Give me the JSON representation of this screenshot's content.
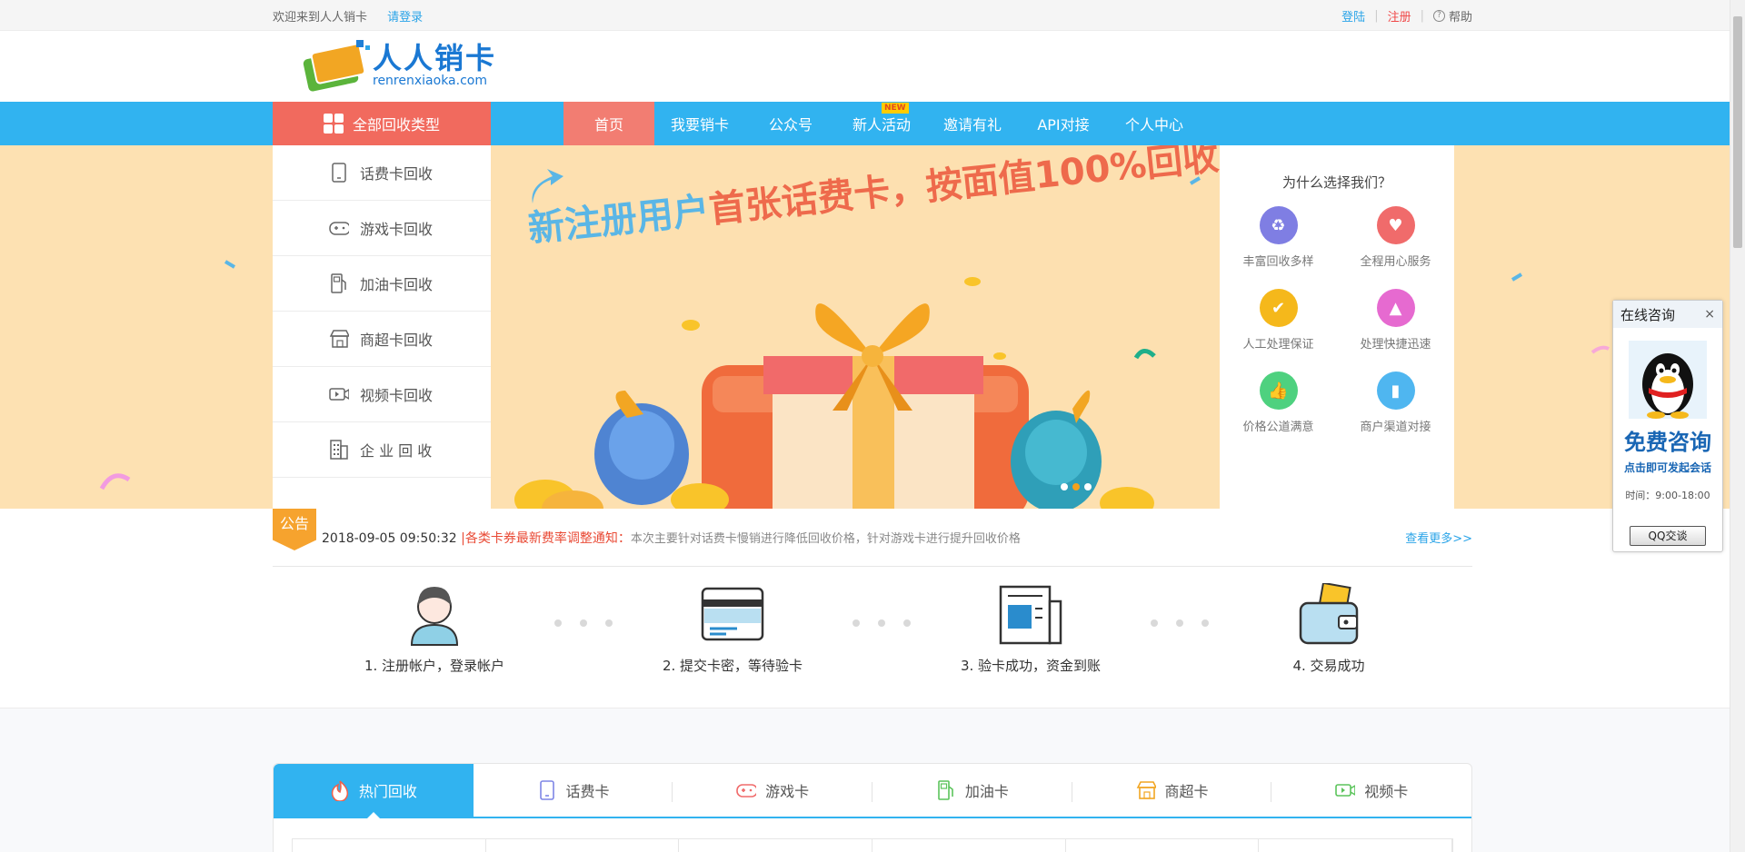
{
  "topbar": {
    "welcome": "欢迎来到人人销卡",
    "please_login": "请登录",
    "login": "登陆",
    "register": "注册",
    "help": "帮助"
  },
  "logo": {
    "cn": "人人销卡",
    "en": "renrenxiaoka.com"
  },
  "nav": {
    "all_categories": "全部回收类型",
    "items": [
      {
        "label": "首页",
        "active": true
      },
      {
        "label": "我要销卡"
      },
      {
        "label": "公众号"
      },
      {
        "label": "新人活动",
        "badge": "NEW"
      },
      {
        "label": "邀请有礼"
      },
      {
        "label": "API对接"
      },
      {
        "label": "个人中心"
      }
    ]
  },
  "categories": [
    {
      "label": "话费卡回收",
      "icon": "phone-icon"
    },
    {
      "label": "游戏卡回收",
      "icon": "gamepad-icon"
    },
    {
      "label": "加油卡回收",
      "icon": "fuel-pump-icon"
    },
    {
      "label": "商超卡回收",
      "icon": "store-icon"
    },
    {
      "label": "视频卡回收",
      "icon": "video-icon"
    },
    {
      "label": "企 业 回 收",
      "icon": "building-icon"
    }
  ],
  "banner": {
    "headline_part1": "新注册用户",
    "headline_part2": "首张话费卡，按面值100%回收",
    "active_slide": 2,
    "total_slides": 3
  },
  "why": {
    "title": "为什么选择我们？",
    "items": [
      {
        "label": "丰富回收多样",
        "color": "#7f7ee3",
        "icon": "recycle-icon"
      },
      {
        "label": "全程用心服务",
        "color": "#f06b6b",
        "icon": "heart-icon"
      },
      {
        "label": "人工处理保证",
        "color": "#f5b81b",
        "icon": "shield-icon"
      },
      {
        "label": "处理快捷迅速",
        "color": "#e66ad0",
        "icon": "rocket-icon"
      },
      {
        "label": "价格公道满意",
        "color": "#4ed17f",
        "icon": "thumbs-up-icon"
      },
      {
        "label": "商户渠道对接",
        "color": "#4fb6f0",
        "icon": "usb-icon"
      }
    ]
  },
  "notice": {
    "badge": "公告",
    "time": "2018-09-05 09:50:32",
    "headline": "|各类卡券最新费率调整通知：",
    "body": "本次主要针对话费卡慢销进行降低回收价格，针对游戏卡进行提升回收价格",
    "more": "查看更多>>"
  },
  "steps": [
    {
      "label": "1. 注册帐户，登录帐户",
      "icon": "user-avatar-icon"
    },
    {
      "label": "2. 提交卡密，等待验卡",
      "icon": "card-icon"
    },
    {
      "label": "3. 验卡成功，资金到账",
      "icon": "document-icon"
    },
    {
      "label": "4. 交易成功",
      "icon": "wallet-icon"
    }
  ],
  "tabs": [
    {
      "label": "热门回收",
      "icon": "fire-icon",
      "active": true
    },
    {
      "label": "话费卡",
      "icon": "phone-icon"
    },
    {
      "label": "游戏卡",
      "icon": "gamepad-icon"
    },
    {
      "label": "加油卡",
      "icon": "fuel-pump-icon"
    },
    {
      "label": "商超卡",
      "icon": "store-icon"
    },
    {
      "label": "视频卡",
      "icon": "video-icon"
    }
  ],
  "consult": {
    "title": "在线咨询",
    "close": "×",
    "big": "免费咨询",
    "sub": "点击即可发起会话",
    "time": "时间：9:00-18:00",
    "button": "QQ交谈"
  },
  "colors": {
    "nav_blue": "#31b3f0",
    "accent_red": "#f16a5e",
    "banner_bg": "#fde1b2",
    "notice_orange": "#f6a32e"
  }
}
